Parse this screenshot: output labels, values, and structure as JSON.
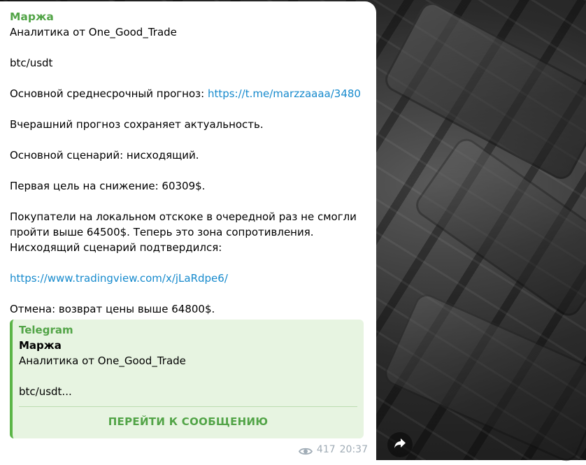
{
  "message": {
    "sender": "Маржа",
    "lines": [
      "Аналитика от One_Good_Trade",
      "",
      "btc/usdt",
      "",
      "Основной среднесрочный прогноз: ",
      "",
      "Вчерашний прогноз сохраняет актуальность.",
      "",
      "Основной сценарий: нисходящий.",
      "",
      "Первая цель на снижение: 60309$.",
      "",
      "Покупатели на локальном отскоке в очередной раз не смогли",
      "пройти выше 64500$. Теперь это зона сопротивления.",
      "Нисходящий сценарий подтвердился:",
      "",
      "",
      "",
      "Отмена: возврат цены выше 64800$."
    ],
    "forecast_link": "https://t.me/marzzaaaa/3480",
    "tradingview_link": "https://www.tradingview.com/x/jLaRdpe6/",
    "views": "417",
    "time": "20:37"
  },
  "quote": {
    "source": "Telegram",
    "title": "Маржа",
    "line1": "Аналитика от One_Good_Trade",
    "line3": "btc/usdt...",
    "button_label": "ПЕРЕЙТИ К СООБЩЕНИЮ"
  },
  "icons": {
    "views": "eye-icon",
    "share": "share-arrow-icon"
  },
  "colors": {
    "accent_green": "#52a447",
    "link_blue": "#168acd",
    "quote_bg": "#e7f4e1"
  }
}
